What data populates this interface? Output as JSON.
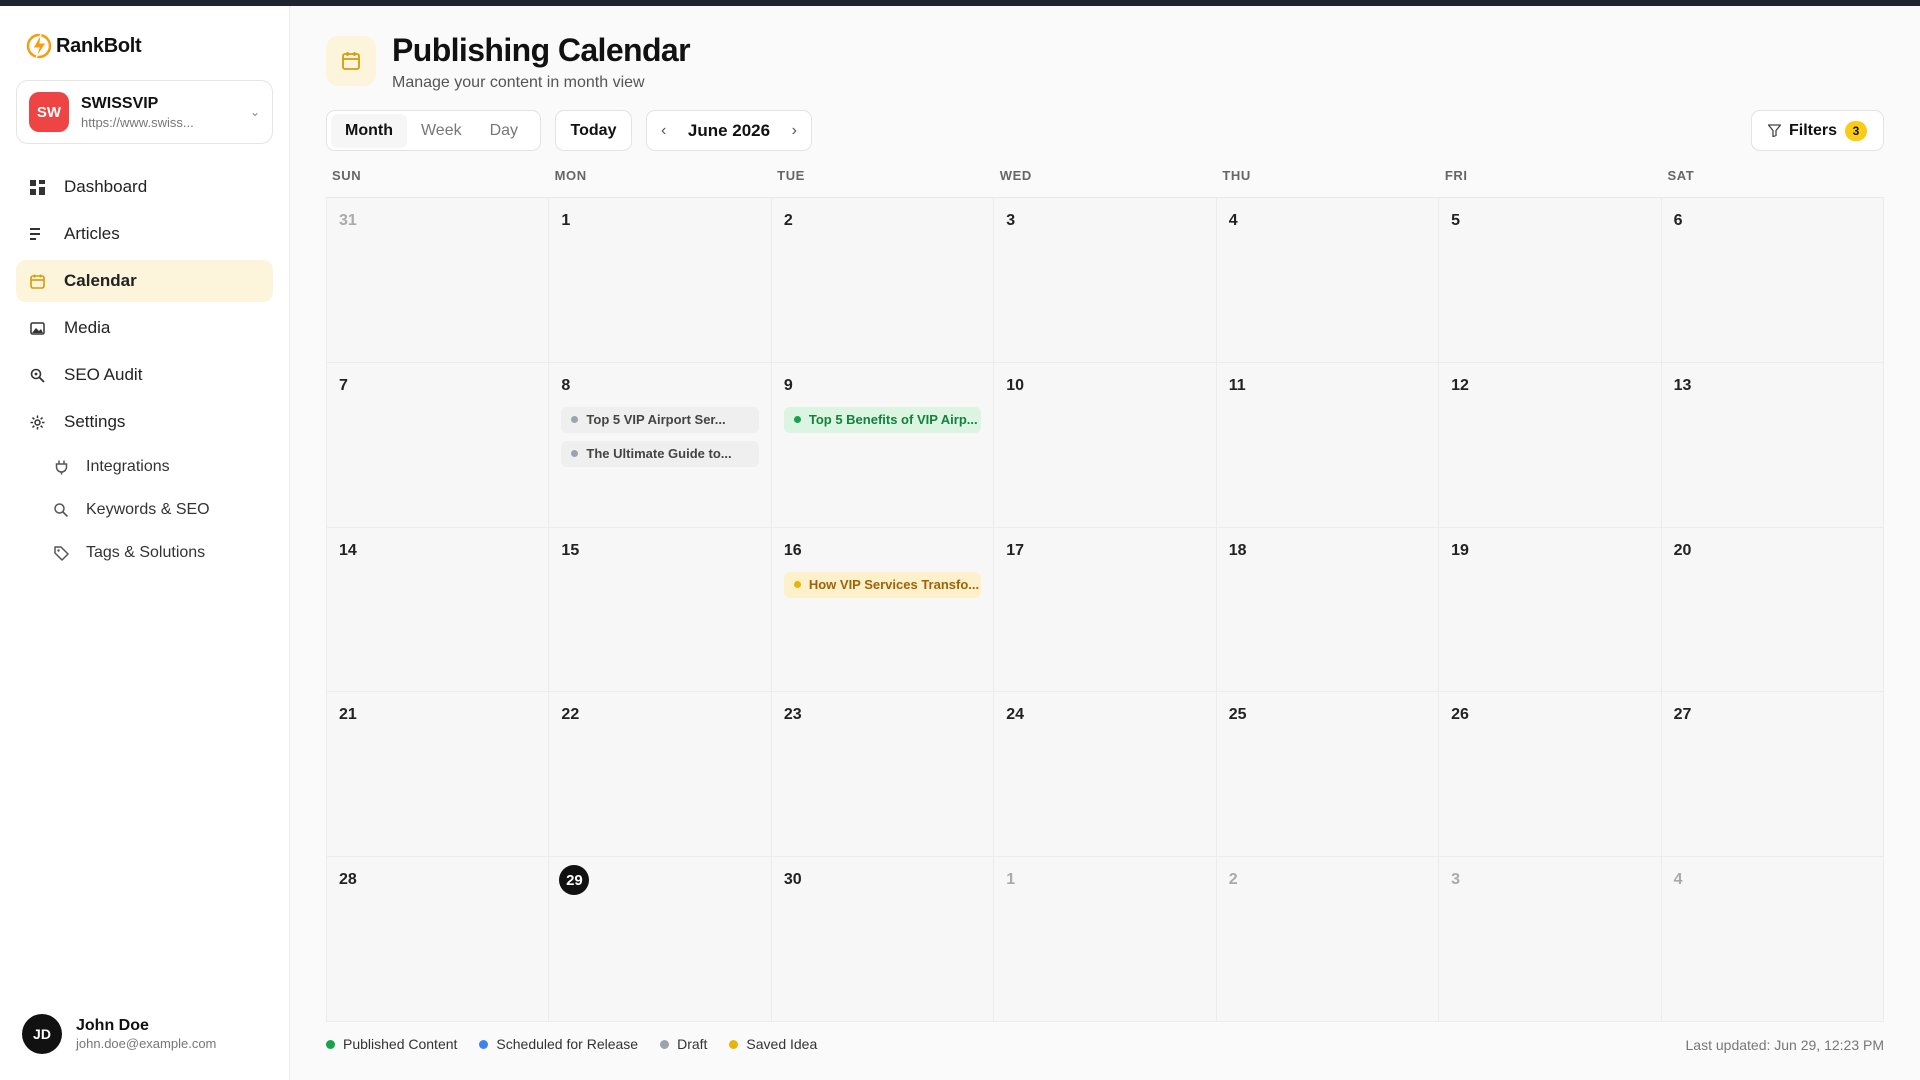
{
  "app": {
    "name": "RankBolt"
  },
  "site": {
    "initials": "SW",
    "name": "SWISSVIP",
    "url": "https://www.swiss..."
  },
  "nav": {
    "dashboard": "Dashboard",
    "articles": "Articles",
    "calendar": "Calendar",
    "media": "Media",
    "seo_audit": "SEO Audit",
    "settings": "Settings",
    "integrations": "Integrations",
    "keywords": "Keywords & SEO",
    "tags": "Tags & Solutions"
  },
  "user": {
    "initials": "JD",
    "name": "John Doe",
    "email": "john.doe@example.com"
  },
  "header": {
    "title": "Publishing Calendar",
    "subtitle": "Manage your content in month view"
  },
  "toolbar": {
    "views": [
      "Month",
      "Week",
      "Day"
    ],
    "active_view": "Month",
    "today_label": "Today",
    "month_label": "June 2026",
    "prev_icon": "‹",
    "next_icon": "›",
    "filters_label": "Filters",
    "filters_count": "3"
  },
  "weekdays": [
    "SUN",
    "MON",
    "TUE",
    "WED",
    "THU",
    "FRI",
    "SAT"
  ],
  "weeks": [
    [
      {
        "d": "31",
        "muted": true
      },
      {
        "d": "1"
      },
      {
        "d": "2"
      },
      {
        "d": "3"
      },
      {
        "d": "4"
      },
      {
        "d": "5"
      },
      {
        "d": "6"
      }
    ],
    [
      {
        "d": "7"
      },
      {
        "d": "8",
        "events": [
          {
            "title": "Top 5 VIP Airport Ser...",
            "status": "draft"
          },
          {
            "title": "The Ultimate Guide to...",
            "status": "draft"
          }
        ]
      },
      {
        "d": "9",
        "events": [
          {
            "title": "Top 5 Benefits of VIP Airp...",
            "status": "published"
          }
        ]
      },
      {
        "d": "10"
      },
      {
        "d": "11"
      },
      {
        "d": "12"
      },
      {
        "d": "13"
      }
    ],
    [
      {
        "d": "14"
      },
      {
        "d": "15"
      },
      {
        "d": "16",
        "events": [
          {
            "title": "How VIP Services Transfo...",
            "status": "idea"
          }
        ]
      },
      {
        "d": "17"
      },
      {
        "d": "18"
      },
      {
        "d": "19"
      },
      {
        "d": "20"
      }
    ],
    [
      {
        "d": "21"
      },
      {
        "d": "22"
      },
      {
        "d": "23"
      },
      {
        "d": "24"
      },
      {
        "d": "25"
      },
      {
        "d": "26"
      },
      {
        "d": "27"
      }
    ],
    [
      {
        "d": "28"
      },
      {
        "d": "29",
        "today": true
      },
      {
        "d": "30"
      },
      {
        "d": "1",
        "muted": true
      },
      {
        "d": "2",
        "muted": true
      },
      {
        "d": "3",
        "muted": true
      },
      {
        "d": "4",
        "muted": true
      }
    ]
  ],
  "legend": [
    {
      "label": "Published Content",
      "color": "#16a34a"
    },
    {
      "label": "Scheduled for Release",
      "color": "#3b82f6"
    },
    {
      "label": "Draft",
      "color": "#9ca3af"
    },
    {
      "label": "Saved Idea",
      "color": "#eab308"
    }
  ],
  "footer": {
    "last_updated": "Last updated: Jun 29, 12:23 PM"
  },
  "colors": {
    "accent": "#fdf4dc",
    "brand_bolt": "#f59e0b",
    "site_avatar": "#ef4444"
  }
}
